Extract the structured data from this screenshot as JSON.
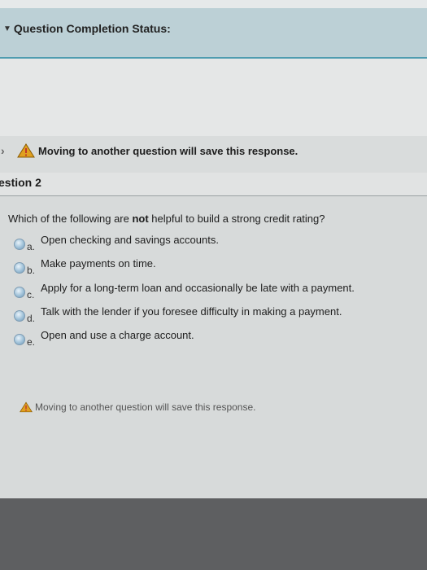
{
  "status_bar": {
    "title": "Question Completion Status:"
  },
  "warning_top": {
    "text": "Moving to another question will save this response."
  },
  "question": {
    "header": "estion 2",
    "text_before": "Which of the following are ",
    "text_emphasis": "not",
    "text_after": " helpful to build a strong credit rating?",
    "options": [
      {
        "letter": "a.",
        "text": "Open checking and savings accounts."
      },
      {
        "letter": "b.",
        "text": "Make payments on time."
      },
      {
        "letter": "c.",
        "text": "Apply for a long-term loan and occasionally be late with a payment."
      },
      {
        "letter": "d.",
        "text": "Talk with the lender if you foresee difficulty in making a payment."
      },
      {
        "letter": "e.",
        "text": "Open and use a charge account."
      }
    ]
  },
  "warning_bottom": {
    "text": "Moving to another question will save this response."
  },
  "colors": {
    "accent": "#4f9cb0",
    "warning": "#e0a020",
    "warning_bang": "#c0392b"
  }
}
